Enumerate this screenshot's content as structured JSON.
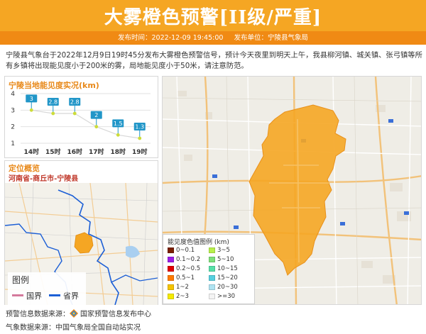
{
  "header": {
    "title": "大雾橙色预警[II级/严重]",
    "publish_time_label": "发布时间：2022-12-09 19:45:00",
    "publisher_label": "发布单位：宁陵县气象局",
    "accent": "#f5a623"
  },
  "description": "宁陵县气象台于2022年12月9日19时45分发布大雾橙色预警信号，预计今天夜里到明天上午，我县柳河镇、城关镇、张弓镇等所有乡镇将出现能见度小于200米的雾，局地能见度小于50米，请注意防范。",
  "visibility_panel": {
    "title": "宁陵当地能见度实况(km)"
  },
  "chart_data": {
    "type": "line",
    "title": "宁陵当地能见度实况(km)",
    "categories": [
      "14时",
      "15时",
      "16时",
      "17时",
      "18时",
      "19时"
    ],
    "series": [
      {
        "values": [
          3,
          2.8,
          2.8,
          2,
          1.5,
          1.3
        ]
      }
    ],
    "value_labels": [
      "3",
      "2.8",
      "2.8",
      "2",
      "1.5",
      "1.3"
    ],
    "yticks": [
      "1",
      "2",
      "3",
      "4"
    ],
    "ylim": [
      1,
      4
    ],
    "grid": true,
    "label_box_color": "#2196c8",
    "point_color": "#cddc39"
  },
  "location_panel": {
    "title": "定位概览",
    "subtitle": "河南省-商丘市-宁陵县",
    "legend": {
      "title": "图例",
      "items": [
        {
          "label": "国界",
          "color": "#d47a9c"
        },
        {
          "label": "省界",
          "color": "#1c5fd6"
        }
      ]
    }
  },
  "map_legend": {
    "title": "能见度色值图例 (km)",
    "items": [
      {
        "label": "0~0.1",
        "color": "#7a1e00"
      },
      {
        "label": "0.1~0.2",
        "color": "#9a1ee6"
      },
      {
        "label": "0.2~0.5",
        "color": "#e00000"
      },
      {
        "label": "0.5~1",
        "color": "#ff7a00"
      },
      {
        "label": "1~2",
        "color": "#f5c400"
      },
      {
        "label": "2~3",
        "color": "#f5ea00"
      },
      {
        "label": "3~5",
        "color": "#b8f04a"
      },
      {
        "label": "5~10",
        "color": "#7ee07a"
      },
      {
        "label": "10~15",
        "color": "#57e0a8"
      },
      {
        "label": "15~20",
        "color": "#57d0e0"
      },
      {
        "label": "20~30",
        "color": "#b0e4f2"
      },
      {
        "label": ">=30",
        "color": "#f4f4f4"
      }
    ]
  },
  "footer": {
    "line1_prefix": "预警信息数据来源：",
    "line1_source": "国家预警信息发布中心",
    "line2_prefix": "气象数据来源：",
    "line2_source": "中国气象局全国自动站实况"
  }
}
